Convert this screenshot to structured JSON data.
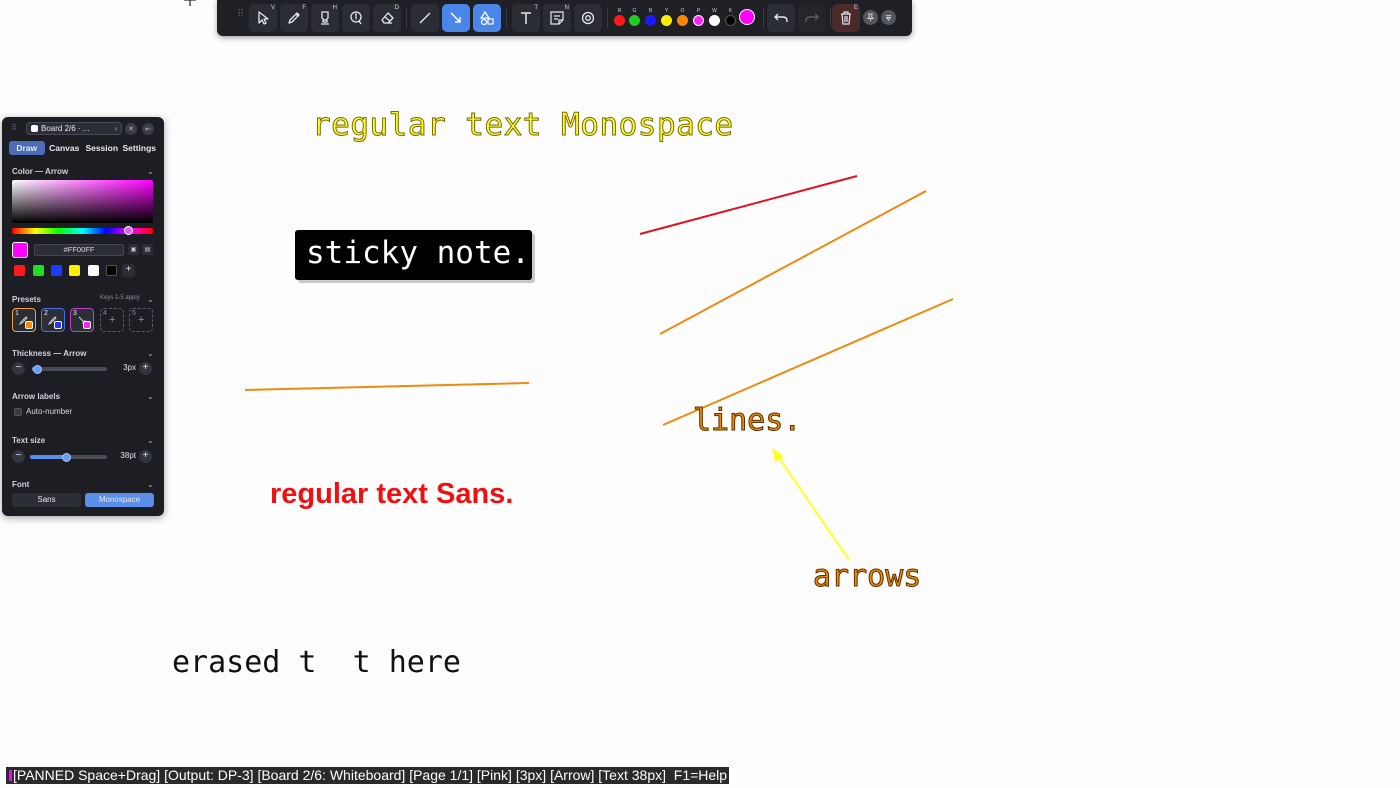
{
  "toolbar": {
    "tools": [
      {
        "name": "select",
        "key": "V"
      },
      {
        "name": "pen",
        "key": "F"
      },
      {
        "name": "highlighter",
        "key": "H"
      },
      {
        "name": "step-marker",
        "key": ""
      },
      {
        "name": "eraser",
        "key": "D"
      },
      {
        "name": "line",
        "key": ""
      },
      {
        "name": "arrow",
        "key": ""
      },
      {
        "name": "shapes",
        "key": ""
      },
      {
        "name": "text",
        "key": "T"
      },
      {
        "name": "sticky-note",
        "key": "N"
      },
      {
        "name": "target",
        "key": ""
      },
      {
        "name": "clear",
        "key": "E"
      }
    ],
    "active_tools": [
      "arrow",
      "shapes"
    ],
    "swatches": [
      {
        "key": "R",
        "color": "#ff1a1a"
      },
      {
        "key": "G",
        "color": "#22cc22"
      },
      {
        "key": "B",
        "color": "#1a1aff"
      },
      {
        "key": "Y",
        "color": "#ffee00"
      },
      {
        "key": "O",
        "color": "#ff8800"
      },
      {
        "key": "P",
        "color": "#ff22ff"
      },
      {
        "key": "W",
        "color": "#ffffff"
      },
      {
        "key": "K",
        "color": "#000000"
      }
    ],
    "current_color": "#ff00ff",
    "icons": {
      "undo": "undo-icon",
      "redo": "redo-icon",
      "clear": "trash-icon",
      "pin": "pin-icon",
      "collapse": "collapse-icon"
    }
  },
  "panel": {
    "board_label": "Board 2/6 · ...",
    "tabs": [
      "Draw",
      "Canvas",
      "Session",
      "Settings"
    ],
    "active_tab": "Draw",
    "color_section": {
      "title": "Color — Arrow",
      "hex_value": "#FF00FF",
      "quick_colors": [
        "#ff1a1a",
        "#22dd22",
        "#1a3cff",
        "#ffee00",
        "#ffffff",
        "#000000"
      ]
    },
    "presets": {
      "title": "Presets",
      "hint": "Keys 1-5 apply",
      "slots": [
        {
          "label": "1",
          "color": "#ff8800",
          "filled": true
        },
        {
          "label": "2",
          "color": "#1a3cff",
          "filled": true
        },
        {
          "label": "3",
          "color": "#ff22ff",
          "filled": true
        },
        {
          "label": "4",
          "color": "",
          "filled": false
        },
        {
          "label": "5",
          "color": "",
          "filled": false
        }
      ]
    },
    "thickness": {
      "title": "Thickness — Arrow",
      "value_label": "3px",
      "level": 0.06
    },
    "arrow_labels": {
      "title": "Arrow labels",
      "auto_number_label": "Auto-number",
      "checked": false
    },
    "text_size": {
      "title": "Text size",
      "value_label": "38pt",
      "level": 0.47
    },
    "font": {
      "title": "Font",
      "options": [
        "Sans",
        "Monospace"
      ],
      "selected": "Monospace"
    }
  },
  "canvas": {
    "text_items": {
      "mono_yellow": "regular text Monospace",
      "sticky": "sticky note.",
      "sans_red": "regular text Sans.",
      "lines_label": "lines.",
      "arrows_label": "arrows",
      "erased": "erased t  t here"
    },
    "colors": {
      "red_line": "#e01020",
      "orange_line": "#ee8a10",
      "yellow_arrow": "#ffff22"
    }
  },
  "status_bar": {
    "text": "[PANNED Space+Drag] [Output: DP-3] [Board 2/6: Whiteboard] [Page 1/1] [Pink] [3px] [Arrow] [Text 38px]  F1=Help",
    "indicator_color": "#ff00ff"
  }
}
